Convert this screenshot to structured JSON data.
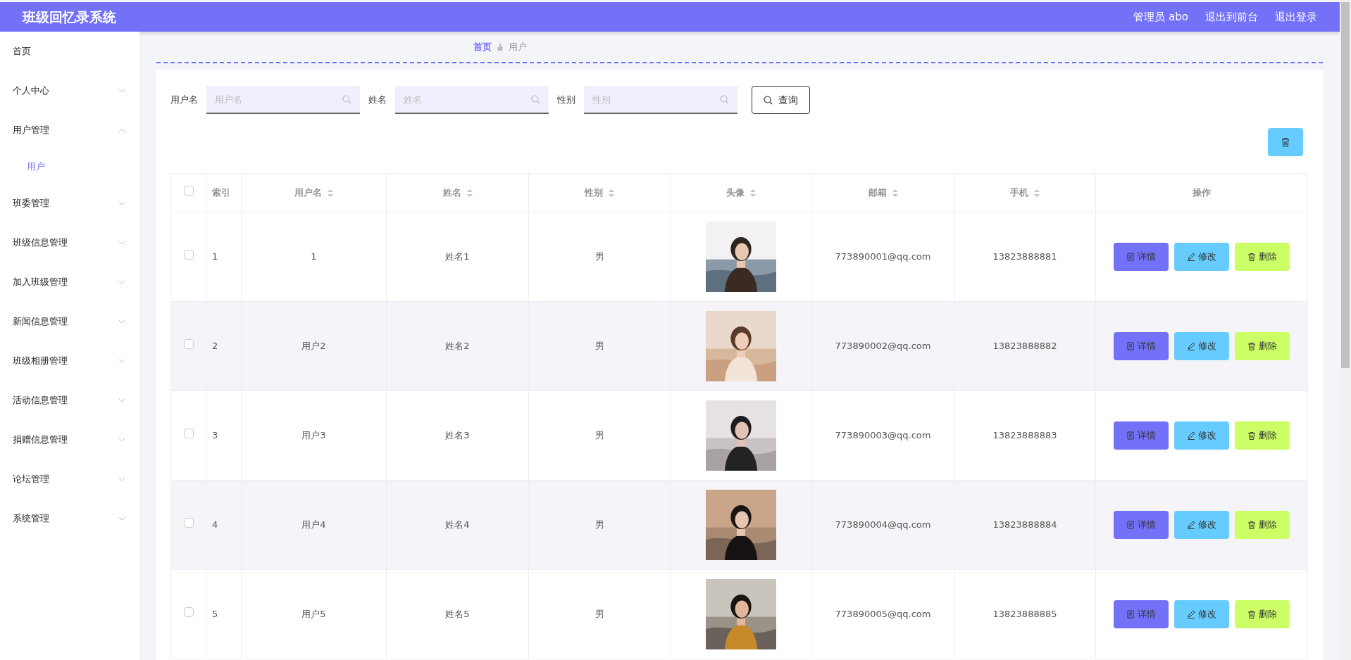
{
  "header": {
    "title": "班级回忆录系统",
    "user": "管理员 abo",
    "links": [
      "退出到前台",
      "退出登录"
    ]
  },
  "sidebar": {
    "items": [
      {
        "kind": "link",
        "label": "首页",
        "selected": false
      },
      {
        "kind": "menu",
        "label": "个人中心",
        "expanded": false
      },
      {
        "kind": "menu",
        "label": "用户管理",
        "expanded": true,
        "children": [
          {
            "label": "用户",
            "selected": true
          }
        ]
      },
      {
        "kind": "menu",
        "label": "班委管理",
        "expanded": false
      },
      {
        "kind": "menu",
        "label": "班级信息管理",
        "expanded": false
      },
      {
        "kind": "menu",
        "label": "加入班级管理",
        "expanded": false
      },
      {
        "kind": "menu",
        "label": "新闻信息管理",
        "expanded": false
      },
      {
        "kind": "menu",
        "label": "班级相册管理",
        "expanded": false
      },
      {
        "kind": "menu",
        "label": "活动信息管理",
        "expanded": false
      },
      {
        "kind": "menu",
        "label": "捐赠信息管理",
        "expanded": false
      },
      {
        "kind": "menu",
        "label": "论坛管理",
        "expanded": false
      },
      {
        "kind": "menu",
        "label": "系统管理",
        "expanded": false
      }
    ]
  },
  "breadcrumb": [
    "首页",
    "用户"
  ],
  "search": {
    "fields": [
      {
        "label": "用户名",
        "placeholder": "用户名"
      },
      {
        "label": "姓名",
        "placeholder": "姓名"
      },
      {
        "label": "性别",
        "placeholder": "性别"
      }
    ],
    "button": "查询"
  },
  "table": {
    "select_all_checked": false,
    "columns": [
      {
        "label": "索引",
        "sortable": false
      },
      {
        "label": "用户名",
        "sortable": true
      },
      {
        "label": "姓名",
        "sortable": true
      },
      {
        "label": "性别",
        "sortable": true
      },
      {
        "label": "头像",
        "sortable": true
      },
      {
        "label": "邮箱",
        "sortable": true
      },
      {
        "label": "手机",
        "sortable": true
      },
      {
        "label": "操作",
        "sortable": false
      }
    ],
    "rows": [
      {
        "checked": false,
        "index": "1",
        "username": "1",
        "name": "姓名1",
        "gender": "男",
        "email": "773890001@qq.com",
        "phone": "13823888881",
        "actions": [
          {
            "kind": "detail",
            "label": "详情"
          },
          {
            "kind": "edit",
            "label": "修改"
          },
          {
            "kind": "delete",
            "label": "删除"
          }
        ]
      },
      {
        "checked": false,
        "index": "2",
        "username": "用户2",
        "name": "姓名2",
        "gender": "男",
        "email": "773890002@qq.com",
        "phone": "13823888882",
        "actions": [
          {
            "kind": "detail",
            "label": "详情"
          },
          {
            "kind": "edit",
            "label": "修改"
          },
          {
            "kind": "delete",
            "label": "删除"
          }
        ]
      },
      {
        "checked": false,
        "index": "3",
        "username": "用户3",
        "name": "姓名3",
        "gender": "男",
        "email": "773890003@qq.com",
        "phone": "13823888883",
        "actions": [
          {
            "kind": "detail",
            "label": "详情"
          },
          {
            "kind": "edit",
            "label": "修改"
          },
          {
            "kind": "delete",
            "label": "删除"
          }
        ]
      },
      {
        "checked": false,
        "index": "4",
        "username": "用户4",
        "name": "姓名4",
        "gender": "男",
        "email": "773890004@qq.com",
        "phone": "13823888884",
        "actions": [
          {
            "kind": "detail",
            "label": "详情"
          },
          {
            "kind": "edit",
            "label": "修改"
          },
          {
            "kind": "delete",
            "label": "删除"
          }
        ]
      },
      {
        "checked": false,
        "index": "5",
        "username": "用户5",
        "name": "姓名5",
        "gender": "男",
        "email": "773890005@qq.com",
        "phone": "13823888885",
        "actions": [
          {
            "kind": "detail",
            "label": "详情"
          },
          {
            "kind": "edit",
            "label": "修改"
          },
          {
            "kind": "delete",
            "label": "删除"
          }
        ]
      }
    ]
  }
}
